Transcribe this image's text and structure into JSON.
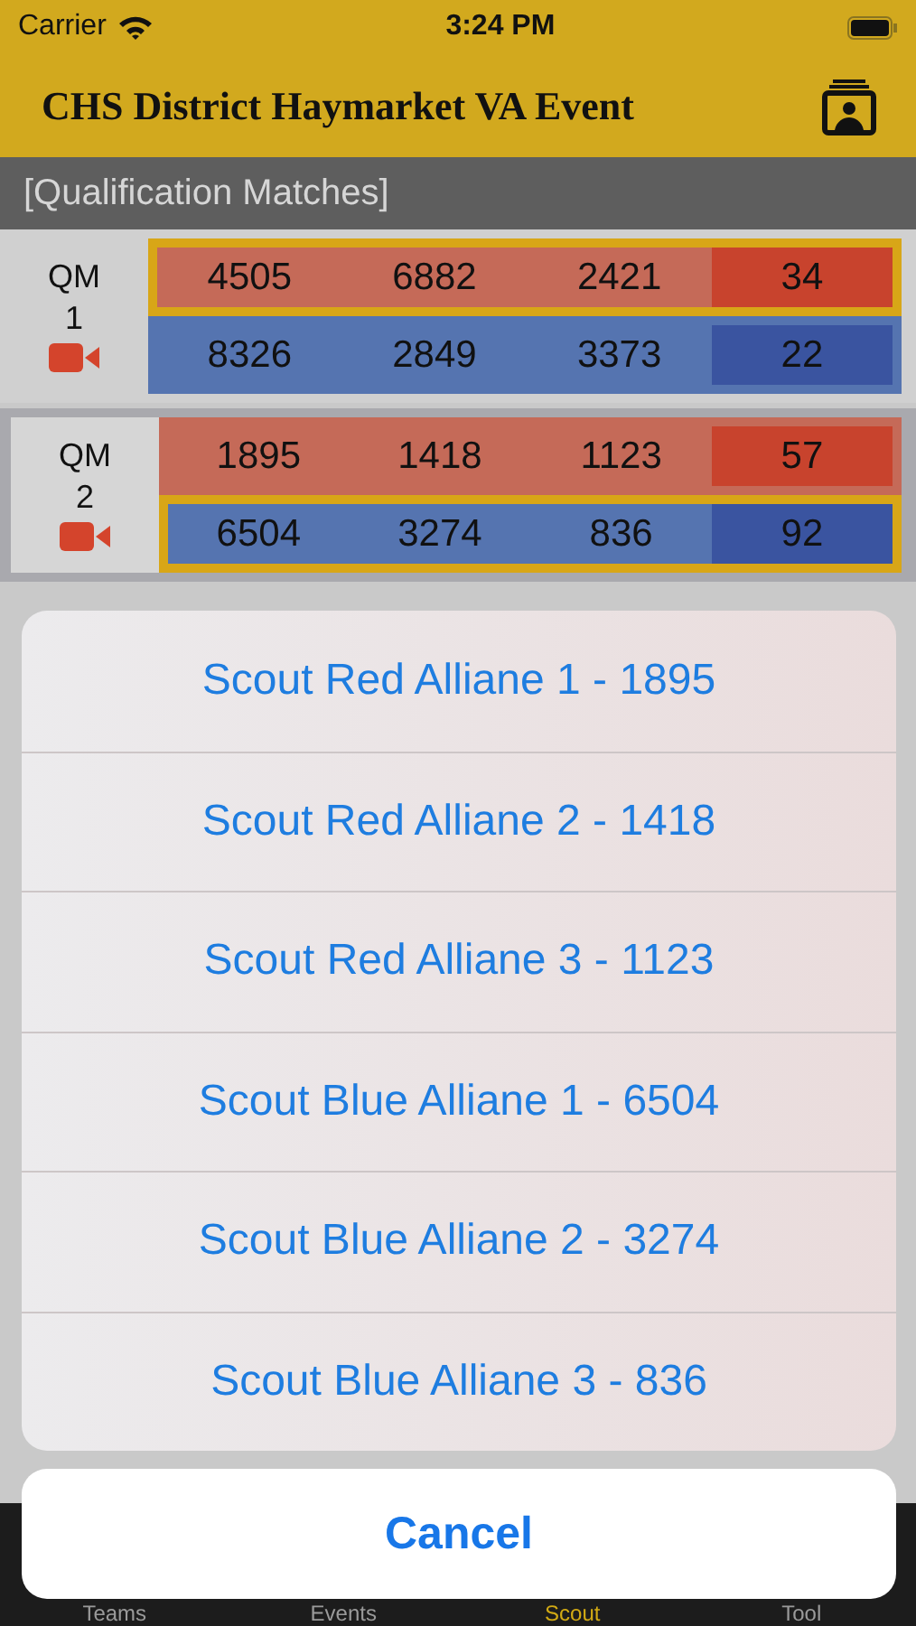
{
  "status_bar": {
    "carrier": "Carrier",
    "time": "3:24 PM"
  },
  "nav_bar": {
    "title": "CHS District Haymarket VA Event"
  },
  "section": {
    "title": "[Qualification Matches]"
  },
  "matches": [
    {
      "label": "QM",
      "number": "1",
      "selected": false,
      "alliances": [
        {
          "kind": "red",
          "highlighted": true,
          "teams": [
            "4505",
            "6882",
            "2421"
          ],
          "score": "34"
        },
        {
          "kind": "blue",
          "highlighted": false,
          "teams": [
            "8326",
            "2849",
            "3373"
          ],
          "score": "22"
        }
      ]
    },
    {
      "label": "QM",
      "number": "2",
      "selected": true,
      "alliances": [
        {
          "kind": "red",
          "highlighted": false,
          "teams": [
            "1895",
            "1418",
            "1123"
          ],
          "score": "57"
        },
        {
          "kind": "blue",
          "highlighted": true,
          "teams": [
            "6504",
            "3274",
            "836"
          ],
          "score": "92"
        }
      ]
    }
  ],
  "action_sheet": {
    "actions": [
      "Scout Red Alliane 1 - 1895",
      "Scout Red Alliane 2 - 1418",
      "Scout Red Alliane 3 - 1123",
      "Scout Blue Alliane 1 - 6504",
      "Scout Blue Alliane 2 - 3274",
      "Scout Blue Alliane 3 - 836"
    ],
    "cancel": "Cancel"
  },
  "tab_bar": [
    {
      "label": "Teams",
      "selected": false
    },
    {
      "label": "Events",
      "selected": false
    },
    {
      "label": "Scout",
      "selected": true
    },
    {
      "label": "Tool",
      "selected": false
    }
  ]
}
